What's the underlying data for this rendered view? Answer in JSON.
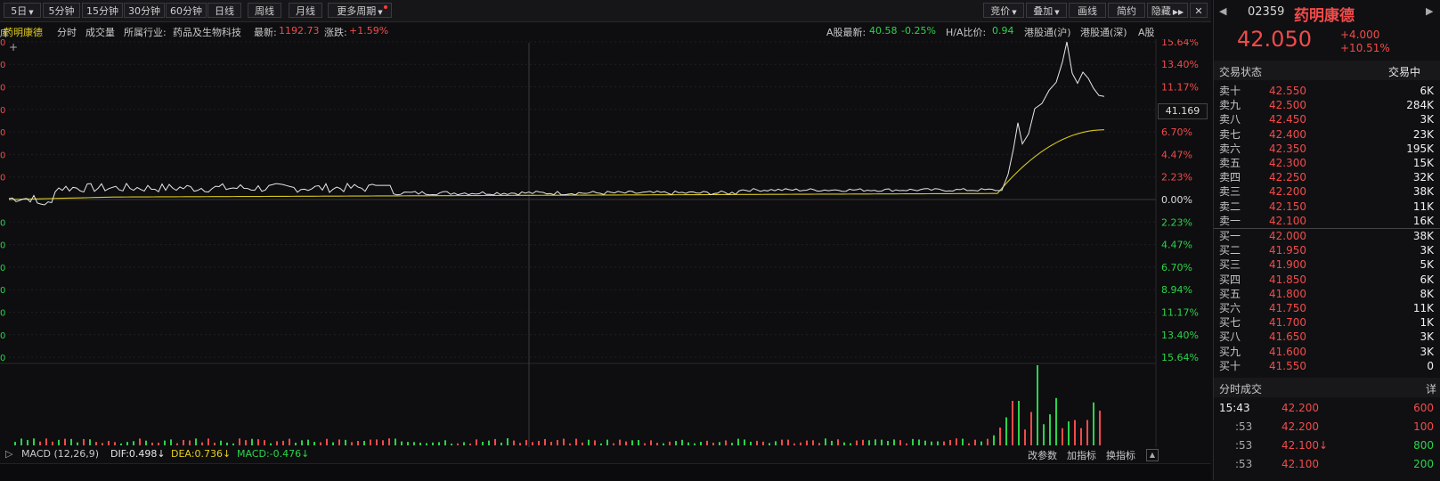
{
  "toolbar": {
    "period_buttons": [
      "5日",
      "5分钟",
      "15分钟",
      "30分钟",
      "60分钟",
      "日线",
      "周线",
      "月线",
      "更多周期"
    ],
    "right_buttons": [
      "竞价",
      "叠加",
      "画线",
      "简约",
      "隐藏"
    ]
  },
  "info": {
    "stock_name": "药明康德",
    "mode": "分时",
    "volume_label": "成交量",
    "industry_label": "所属行业:",
    "industry": "药品及生物科技",
    "latest_label": "最新:",
    "latest": "1192.73",
    "change_label": "涨跌:",
    "change": "+1.59%",
    "a_share_label": "A股最新:",
    "a_share_price": "40.58",
    "a_share_change": "-0.25%",
    "ha_ratio_label": "H/A比价:",
    "ha_ratio": "0.94",
    "link_sh": "港股通(沪)",
    "link_sz": "港股通(深)",
    "a_share_short": "A股"
  },
  "chart": {
    "pct_axis_up": [
      "15.64%",
      "13.40%",
      "11.17%",
      "8.94%",
      "6.70%",
      "4.47%",
      "2.23%"
    ],
    "zero_label": "0.00%",
    "pct_axis_down": [
      "2.23%",
      "4.47%",
      "6.70%",
      "8.94%",
      "11.17%",
      "13.40%",
      "15.64%"
    ],
    "cursor_price": "41.169",
    "macd_label": "MACD (12,26,9)",
    "dif": "DIF:0.498↓",
    "dea": "DEA:0.736↓",
    "macd": "MACD:-0.476↓",
    "bottom_links": [
      "改参数",
      "加指标",
      "换指标"
    ],
    "colors": {
      "price_line": "#e8e8e8",
      "avg_line": "#d7c81e",
      "up": "#f24b4b",
      "down": "#2bd44a"
    }
  },
  "quote": {
    "code": "02359",
    "name": "药明康德",
    "price": "42.050",
    "change": "+4.000",
    "change_pct": "+10.51%",
    "status_label": "交易状态",
    "status_value": "交易中"
  },
  "orderbook": {
    "asks": [
      {
        "label": "卖十",
        "price": "42.550",
        "vol": "6K"
      },
      {
        "label": "卖九",
        "price": "42.500",
        "vol": "284K"
      },
      {
        "label": "卖八",
        "price": "42.450",
        "vol": "3K"
      },
      {
        "label": "卖七",
        "price": "42.400",
        "vol": "23K"
      },
      {
        "label": "卖六",
        "price": "42.350",
        "vol": "195K"
      },
      {
        "label": "卖五",
        "price": "42.300",
        "vol": "15K"
      },
      {
        "label": "卖四",
        "price": "42.250",
        "vol": "32K"
      },
      {
        "label": "卖三",
        "price": "42.200",
        "vol": "38K"
      },
      {
        "label": "卖二",
        "price": "42.150",
        "vol": "11K"
      },
      {
        "label": "卖一",
        "price": "42.100",
        "vol": "16K"
      }
    ],
    "bids": [
      {
        "label": "买一",
        "price": "42.000",
        "vol": "38K"
      },
      {
        "label": "买二",
        "price": "41.950",
        "vol": "3K"
      },
      {
        "label": "买三",
        "price": "41.900",
        "vol": "5K"
      },
      {
        "label": "买四",
        "price": "41.850",
        "vol": "6K"
      },
      {
        "label": "买五",
        "price": "41.800",
        "vol": "8K"
      },
      {
        "label": "买六",
        "price": "41.750",
        "vol": "11K"
      },
      {
        "label": "买七",
        "price": "41.700",
        "vol": "1K"
      },
      {
        "label": "买八",
        "price": "41.650",
        "vol": "3K"
      },
      {
        "label": "买九",
        "price": "41.600",
        "vol": "3K"
      },
      {
        "label": "买十",
        "price": "41.550",
        "vol": "0"
      }
    ]
  },
  "ticks": {
    "title": "分时成交",
    "detail": "详",
    "rows": [
      {
        "time": "15:43",
        "price": "42.200",
        "vol": "600",
        "color": "#f24b4b"
      },
      {
        "time": ":53",
        "price": "42.200",
        "vol": "100",
        "color": "#f24b4b"
      },
      {
        "time": ":53",
        "price": "42.100",
        "vol": "800",
        "color": "#2bd44a",
        "arrow": "↓"
      },
      {
        "time": ":53",
        "price": "42.100",
        "vol": "200",
        "color": "#2bd44a"
      }
    ]
  }
}
